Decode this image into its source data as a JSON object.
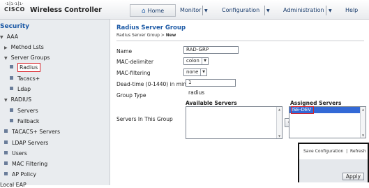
{
  "header": {
    "logo_bars": "·ı|ı·ı|ı·",
    "logo_word": "CISCO",
    "app_title": "Wireless Controller",
    "home_label": "Home",
    "monitor_label": "Monitor",
    "configuration_label": "Configuration",
    "administration_label": "Administration",
    "help_label": "Help"
  },
  "sidebar": {
    "title": "Security",
    "aaa": "AAA",
    "method_lists": "Method Lsts",
    "server_groups": "Server Groups",
    "radius": "Radius",
    "tacacs": "Tacacs+",
    "ldap": "Ldap",
    "radius_section": "RADIUS",
    "servers": "Servers",
    "fallback": "Fallback",
    "tacacs_servers": "TACACS+ Servers",
    "ldap_servers": "LDAP Servers",
    "users": "Users",
    "mac_filtering": "MAC Filtering",
    "ap_policy": "AP Policy",
    "local_eap": "Local EAP"
  },
  "main": {
    "title": "Radius Server Group",
    "breadcrumb_prefix": "Radius Server Group > ",
    "breadcrumb_current": "New",
    "name_label": "Name",
    "name_value": "RAD-GRP",
    "mac_delimiter_label": "MAC-delimiter",
    "mac_delimiter_value": "colon",
    "mac_filtering_label": "MAC-filtering",
    "mac_filtering_value": "none",
    "dead_time_label": "Dead-time (0-1440) in minutes",
    "dead_time_value": "1",
    "group_type_label": "Group Type",
    "group_type_value": "radius",
    "available_servers_label": "Available Servers",
    "assigned_servers_label": "Assigned Servers",
    "servers_in_group_label": "Servers In This Group",
    "assigned_servers": [
      "ISE-DEV"
    ],
    "move_left": "<",
    "move_right": ">"
  },
  "popup": {
    "save_configuration": "Save Configuration",
    "separator": "|",
    "refresh": "Refresh",
    "apply": "Apply"
  }
}
